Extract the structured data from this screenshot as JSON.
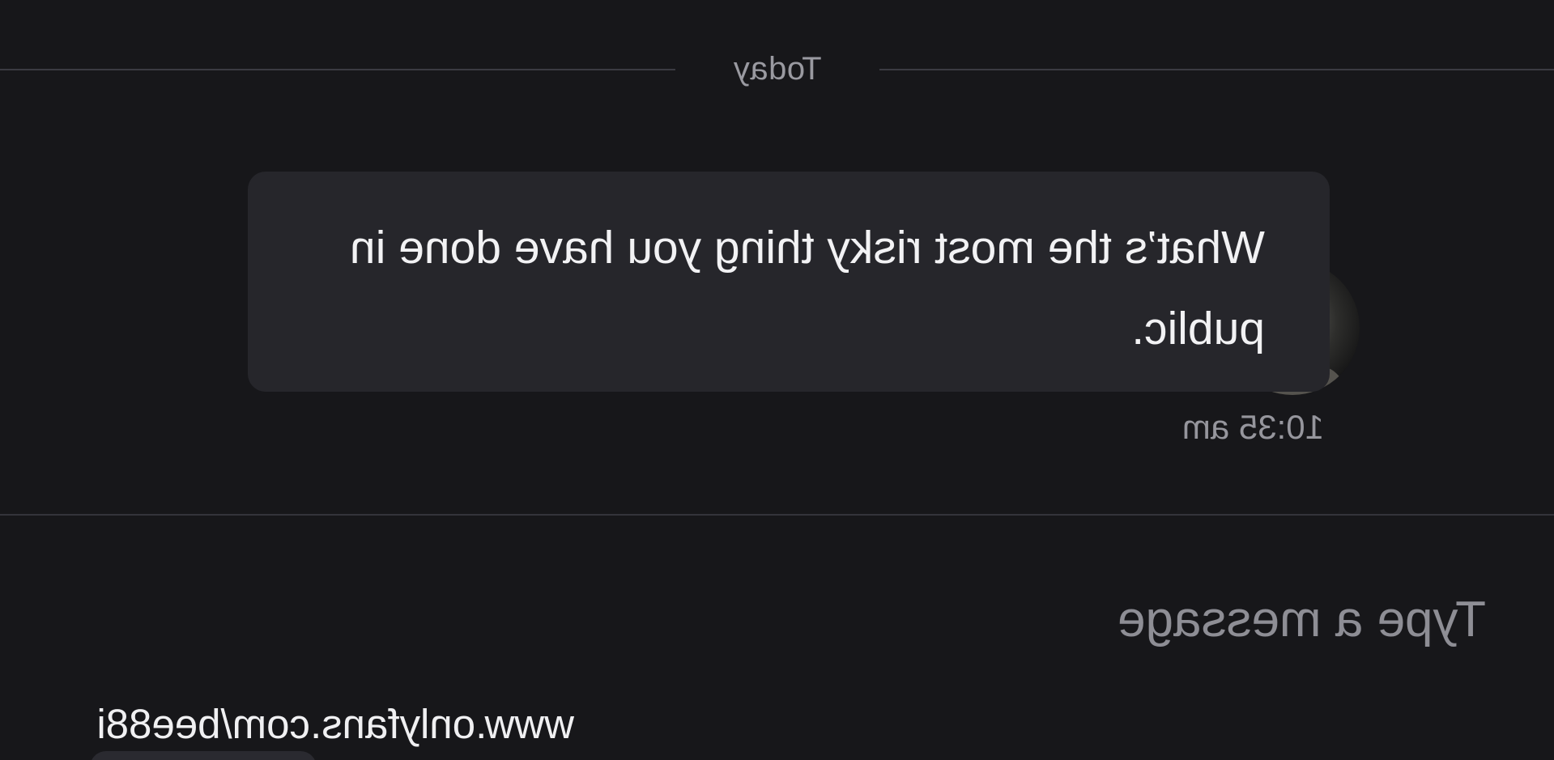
{
  "date_separator": {
    "label": "Today"
  },
  "message": {
    "text": "What’s the most risky thing you have done in public.",
    "time": "10:35 am",
    "avatar_icon": "clown-avatar"
  },
  "composer": {
    "placeholder": "Type a message"
  },
  "watermark": {
    "text": "www.onlyfans.com/bee88i"
  },
  "colors": {
    "background": "#17171a",
    "bubble": "#26262b",
    "separator": "#3b3b42",
    "muted_text": "#9a9aa1"
  },
  "layout_note_mirrored": true
}
